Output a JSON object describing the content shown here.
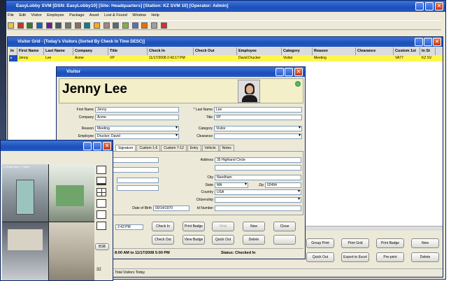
{
  "main_window": {
    "title": "EasyLobby SVM  [DSN: EasyLobby10]  [Site: Headquarters]  [Station: KZ SVM 10]  [Operator: Admin]",
    "menu": [
      "File",
      "Edit",
      "Visitor",
      "Employee",
      "Package",
      "Asset",
      "Lost & Found",
      "Window",
      "Help"
    ]
  },
  "grid_window": {
    "title": "Visitor Grid - [Today's Visitors (Sorted By Check In Time DESC)]",
    "columns": [
      "In",
      "First Name",
      "Last Name",
      "Company",
      "Title",
      "Check In",
      "Check Out",
      "Employee",
      "Category",
      "Reason",
      "Clearance",
      "Custom 1st",
      "In St"
    ],
    "rows": [
      {
        "in": "",
        "first": "Jenny",
        "last": "Lee",
        "company": "Acme",
        "title": "VP",
        "check_in": "11/17/2008 2:43:17 PM",
        "check_out": "",
        "employee": "David Drucker",
        "category": "Visitor",
        "reason": "Meeting",
        "clearance": "",
        "custom": "VA77",
        "st": "KZ SV"
      }
    ],
    "footer_text": "1 In, 1 Total Visitors Today",
    "buttons": [
      "Group Print",
      "Print Grid",
      "Print Badge",
      "New",
      "Quick Out",
      "Export to Excel",
      "Pre-print",
      "Delete"
    ]
  },
  "visitor_window": {
    "title": "Visitor",
    "name": "Jenny Lee",
    "fields": {
      "first_name_label": "First Name",
      "first_name": "Jenny",
      "last_name_label": "* Last Name",
      "last_name": "Lee",
      "company_label": "Company",
      "company": "Acme",
      "title_label": "Title",
      "title": "VP",
      "reason_label": "Reason",
      "reason": "Meeting",
      "category_label": "Category",
      "category": "Visitor",
      "employee_label": "Employee",
      "employee": "Drucker, David",
      "clearance_label": "Clearance",
      "clearance": "",
      "address_label": "Address",
      "address": "35 Highland Circle",
      "city_label": "City",
      "city": "Needham",
      "state_label": "State",
      "state": "MA",
      "zip_label": "Zip",
      "zip": "02494",
      "country_label": "Country",
      "country": "USA",
      "citizenship_label": "Citizenship",
      "citizenship": "",
      "dob_label": "Date of Birth",
      "dob": "00/14/1970",
      "idnumber_label": "Id Number",
      "idnumber": ""
    },
    "tabs": [
      "Signature",
      "Custom 1-6",
      "Custom 7-12",
      "Entry",
      "Vehicle",
      "Notes"
    ],
    "partial_labels": {
      "left1": "h",
      "left2": "m"
    },
    "checkin_time": "2:43 PM",
    "buttons_row1": [
      "Check In",
      "Print Badge",
      "Find",
      "New",
      "Close"
    ],
    "buttons_row2": [
      "Check Out",
      "View Badge",
      "Quick Out",
      "Delete",
      ""
    ],
    "status_window": "8:00 AM to 11/17/2008 5:00 PM",
    "status": "Status: Checked In"
  },
  "camera_window": {
    "label_top": "4 Grids view_1 Video",
    "split_label": "BSB",
    "counter": "32"
  }
}
